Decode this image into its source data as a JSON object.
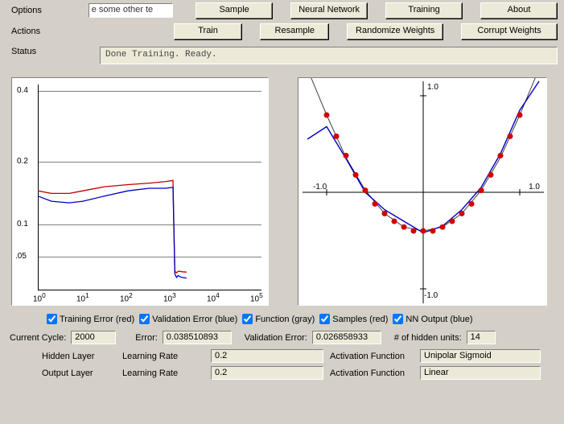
{
  "top": {
    "options_label": "Options",
    "actions_label": "Actions",
    "status_label": "Status",
    "text_snippet": "e some other te",
    "tabs": {
      "sample": "Sample",
      "nn": "Neural Network",
      "training": "Training",
      "about": "About"
    },
    "actions": {
      "train": "Train",
      "resample": "Resample",
      "randomize": "Randomize Weights",
      "corrupt": "Corrupt Weights"
    },
    "status_text": "Done Training. Ready."
  },
  "checks": {
    "train_err": "Training Error (red)",
    "val_err": "Validation Error (blue)",
    "func": "Function (gray)",
    "samples": "Samples (red)",
    "nn_out": "NN Output (blue)"
  },
  "metrics": {
    "cycle_label": "Current Cycle:",
    "cycle": "2000",
    "error_label": "Error:",
    "error": "0.038510893",
    "valerr_label": "Validation Error:",
    "valerr": "0.026858933",
    "hidden_label": "# of hidden units:",
    "hidden": "14"
  },
  "params": {
    "hidden_layer": "Hidden Layer",
    "output_layer": "Output Layer",
    "lr_label": "Learning Rate",
    "af_label": "Activation Function",
    "hidden_lr": "0.2",
    "output_lr": "0.2",
    "hidden_af": "Unipolar Sigmoid",
    "output_af": "Linear"
  },
  "chart_data": [
    {
      "type": "line",
      "title": "",
      "xscale": "log",
      "xlabel": "",
      "ylabel": "",
      "xticks": [
        "10^0",
        "10^1",
        "10^2",
        "10^3",
        "10^4",
        "10^5"
      ],
      "yticks": [
        0.05,
        0.1,
        0.2,
        0.4
      ],
      "ylim": [
        0,
        0.4
      ],
      "series": [
        {
          "name": "Training Error",
          "color": "#c00000",
          "x": [
            1,
            2,
            5,
            10,
            30,
            100,
            300,
            700,
            1000,
            1100,
            1200,
            1300,
            1400,
            1600,
            2000
          ],
          "y": [
            0.195,
            0.19,
            0.19,
            0.195,
            0.203,
            0.207,
            0.21,
            0.213,
            0.215,
            0.04,
            0.037,
            0.04,
            0.04,
            0.039,
            0.0385
          ]
        },
        {
          "name": "Validation Error",
          "color": "#0000c0",
          "x": [
            1,
            2,
            5,
            10,
            30,
            100,
            300,
            700,
            1000,
            1100,
            1200,
            1300,
            1400,
            1600,
            2000
          ],
          "y": [
            0.185,
            0.175,
            0.172,
            0.175,
            0.185,
            0.195,
            0.2,
            0.2,
            0.202,
            0.035,
            0.028,
            0.032,
            0.03,
            0.028,
            0.0269
          ]
        }
      ]
    },
    {
      "type": "scatter+line",
      "title": "",
      "xlim": [
        -1.2,
        1.2
      ],
      "ylim": [
        -1.2,
        1.2
      ],
      "xticks": [
        -1.0,
        1.0
      ],
      "yticks": [
        -1.0,
        1.0
      ],
      "series": [
        {
          "name": "Function",
          "type": "line",
          "color": "#404040",
          "x": [
            -1.2,
            -1.0,
            -0.8,
            -0.6,
            -0.4,
            -0.2,
            0,
            0.2,
            0.4,
            0.6,
            0.8,
            1.0,
            1.2
          ],
          "y": [
            1.28,
            0.8,
            0.36,
            0.02,
            -0.22,
            -0.36,
            -0.4,
            -0.36,
            -0.22,
            0.02,
            0.36,
            0.8,
            1.28
          ]
        },
        {
          "name": "NN Output",
          "type": "line",
          "color": "#0000c0",
          "x": [
            -1.2,
            -1.0,
            -0.8,
            -0.6,
            -0.4,
            -0.2,
            0,
            0.2,
            0.4,
            0.6,
            0.8,
            1.0,
            1.2
          ],
          "y": [
            0.55,
            0.68,
            0.35,
            0.0,
            -0.18,
            -0.3,
            -0.42,
            -0.35,
            -0.18,
            0.05,
            0.4,
            0.85,
            1.15
          ]
        },
        {
          "name": "Samples",
          "type": "scatter",
          "color": "#d00000",
          "x": [
            -1.0,
            -0.9,
            -0.8,
            -0.7,
            -0.6,
            -0.5,
            -0.4,
            -0.3,
            -0.2,
            -0.1,
            0.0,
            0.1,
            0.2,
            0.3,
            0.4,
            0.5,
            0.6,
            0.7,
            0.8,
            0.9,
            1.0
          ],
          "y": [
            0.8,
            0.58,
            0.38,
            0.18,
            0.02,
            -0.12,
            -0.22,
            -0.3,
            -0.36,
            -0.4,
            -0.4,
            -0.4,
            -0.36,
            -0.3,
            -0.22,
            -0.12,
            0.02,
            0.18,
            0.38,
            0.58,
            0.8
          ]
        }
      ]
    }
  ]
}
